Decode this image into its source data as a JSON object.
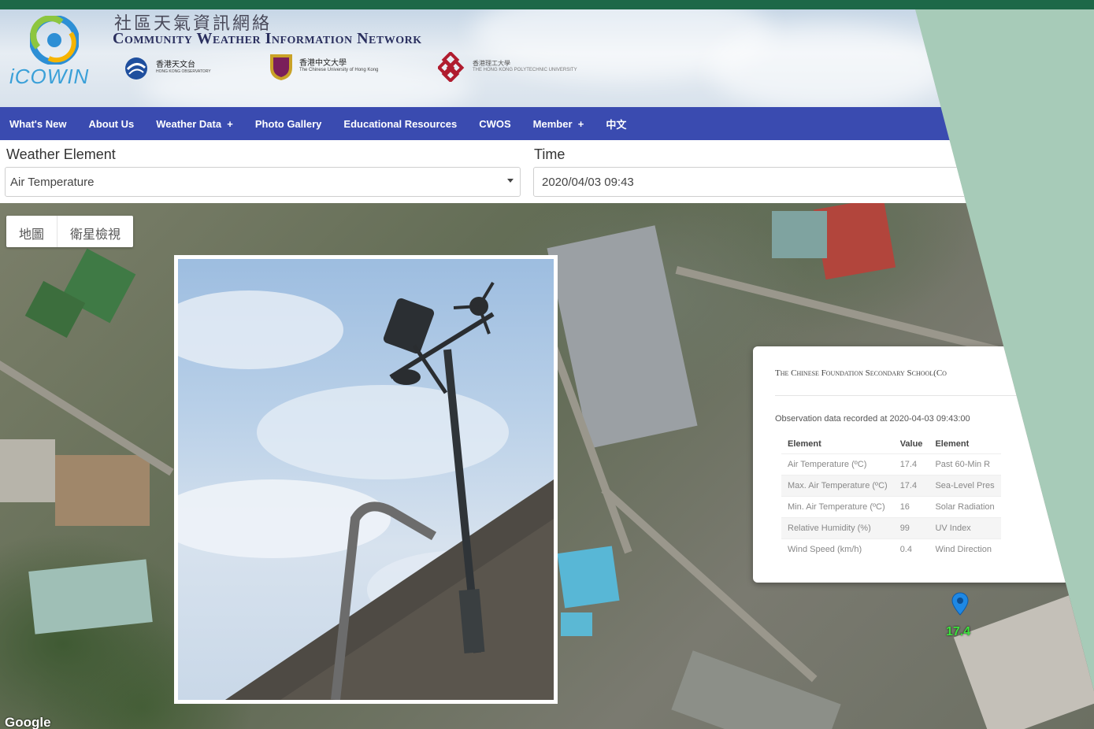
{
  "header": {
    "title_zh": "社區天氣資訊網絡",
    "title_en": "Community Weather Information Network",
    "logo_text": "iCOWIN",
    "partners": [
      {
        "name_zh": "香港天文台",
        "name_en": "HONG KONG OBSERVATORY"
      },
      {
        "name_zh": "香港中文大學",
        "name_en": "The Chinese University of Hong Kong"
      },
      {
        "name_zh": "香港理工大學",
        "name_en": "THE HONG KONG POLYTECHNIC UNIVERSITY"
      }
    ]
  },
  "nav": {
    "items": [
      "What's New",
      "About Us",
      "Weather Data  +",
      "Photo Gallery",
      "Educational Resources",
      "CWOS",
      "Member  +",
      "中文"
    ]
  },
  "controls": {
    "element_label": "Weather Element",
    "element_value": "Air Temperature",
    "time_label": "Time",
    "time_value": "2020/04/03 09:43"
  },
  "map": {
    "type_buttons": [
      "地圖",
      "衛星檢視"
    ],
    "attribution": "Google",
    "marker_value": "17.4"
  },
  "info_window": {
    "title": "The Chinese Foundation Secondary School(Co",
    "observation": "Observation data recorded at 2020-04-03 09:43:00",
    "columns": [
      "Element",
      "Value",
      "Element"
    ],
    "rows": [
      [
        "Air Temperature (ºC)",
        "17.4",
        "Past 60-Min R"
      ],
      [
        "Max. Air Temperature (ºC)",
        "17.4",
        "Sea-Level Pres"
      ],
      [
        "Min. Air Temperature (ºC)",
        "16",
        "Solar Radiation"
      ],
      [
        "Relative Humidity (%)",
        "99",
        "UV Index"
      ],
      [
        "Wind Speed (km/h)",
        "0.4",
        "Wind Direction"
      ]
    ]
  },
  "colors": {
    "nav": "#3a4bb0",
    "frame_green": "#1d6848",
    "background_mint": "#a7cbb8",
    "marker": "#1e88e5",
    "marker_label": "#3ce33c"
  }
}
